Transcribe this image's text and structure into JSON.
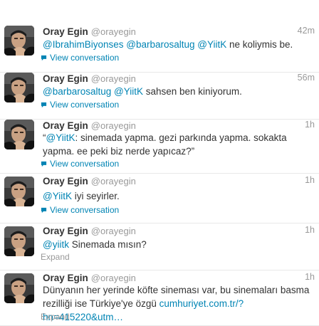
{
  "tweets": [
    {
      "name": "Oray Egin",
      "handle": "@orayegin",
      "time": "42m",
      "parts": [
        {
          "t": "@IbrahimBiyonses",
          "link": true
        },
        {
          "t": " ",
          "link": false
        },
        {
          "t": "@barbarosaltug",
          "link": true
        },
        {
          "t": " ",
          "link": false
        },
        {
          "t": "@YiitK",
          "link": true
        },
        {
          "t": " ne koliymis be.",
          "link": false
        }
      ],
      "action": "View conversation",
      "action_type": "conversation"
    },
    {
      "name": "Oray Egin",
      "handle": "@orayegin",
      "time": "56m",
      "parts": [
        {
          "t": "@barbarosaltug",
          "link": true
        },
        {
          "t": " ",
          "link": false
        },
        {
          "t": "@YiitK",
          "link": true
        },
        {
          "t": " sahsen ben kiniyorum.",
          "link": false
        }
      ],
      "action": "View conversation",
      "action_type": "conversation"
    },
    {
      "name": "Oray Egin",
      "handle": "@orayegin",
      "time": "1h",
      "parts": [
        {
          "t": "“",
          "link": false
        },
        {
          "t": "@YiitK",
          "link": true
        },
        {
          "t": ": sinemada yapma. gezi parkında yapma. sokakta yapma. ee peki biz nerde yapıcaz?”",
          "link": false
        }
      ],
      "action": "View conversation",
      "action_type": "conversation"
    },
    {
      "name": "Oray Egin",
      "handle": "@orayegin",
      "time": "1h",
      "parts": [
        {
          "t": "@YiitK",
          "link": true
        },
        {
          "t": " iyi seyirler.",
          "link": false
        }
      ],
      "action": "View conversation",
      "action_type": "conversation"
    },
    {
      "name": "Oray Egin",
      "handle": "@orayegin",
      "time": "1h",
      "parts": [
        {
          "t": "@yiitk",
          "link": true
        },
        {
          "t": " Sinemada mısın?",
          "link": false
        }
      ],
      "action": "Expand",
      "action_type": "expand"
    },
    {
      "name": "Oray Egin",
      "handle": "@orayegin",
      "time": "1h",
      "parts": [
        {
          "t": "Dünyanın her yerinde köfte sineması var, bu sinemaları basma rezilliği ise Türkiye'ye özgü ",
          "link": false
        },
        {
          "t": "cumhuriyet.com.tr/?hn=415220&utm…",
          "link": true
        }
      ],
      "action": "Expand",
      "action_type": "expand"
    }
  ],
  "colors": {
    "link": "#0084b4",
    "muted": "#999999",
    "text": "#333333"
  },
  "icons": {
    "conversation": "speech-bubble-icon"
  }
}
